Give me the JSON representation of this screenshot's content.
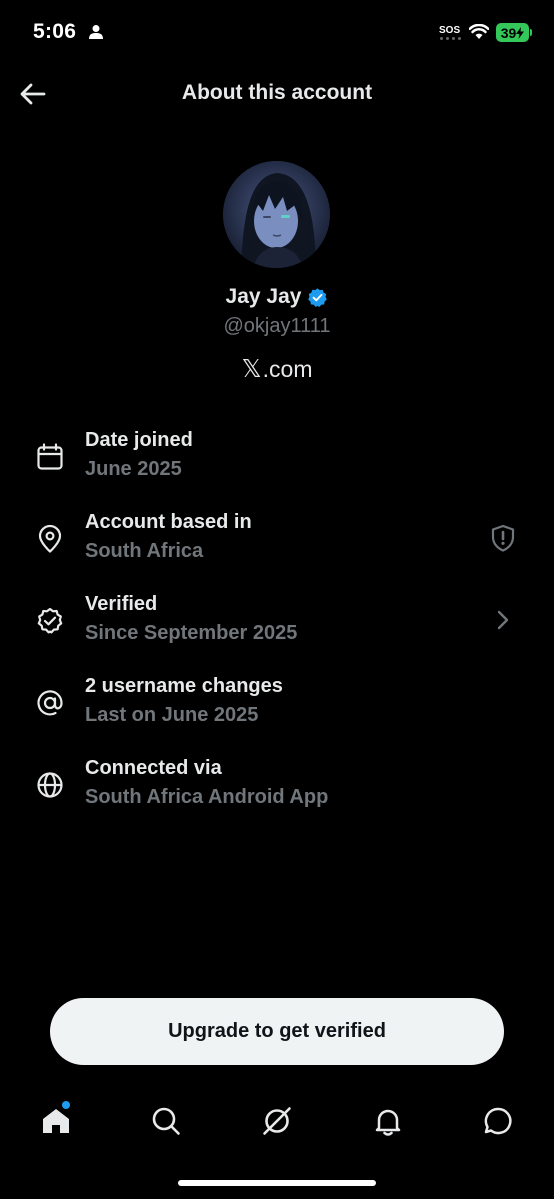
{
  "status_bar": {
    "time": "5:06",
    "sos": "SOS",
    "battery": "39"
  },
  "header": {
    "title": "About this account"
  },
  "profile": {
    "name": "Jay Jay",
    "handle": "@okjay1111",
    "domain_logo": "𝕏",
    "domain_text": ".com"
  },
  "details": [
    {
      "icon": "calendar-icon",
      "title": "Date joined",
      "subtitle": "June 2025"
    },
    {
      "icon": "location-pin-icon",
      "title": "Account based in",
      "subtitle": "South Africa",
      "trailing_icon": "shield-alert-icon"
    },
    {
      "icon": "verified-badge-icon",
      "title": "Verified",
      "subtitle": "Since September 2025",
      "trailing_icon": "chevron-right-icon"
    },
    {
      "icon": "at-sign-icon",
      "title": "2 username changes",
      "subtitle": "Last on June 2025"
    },
    {
      "icon": "globe-icon",
      "title": "Connected via",
      "subtitle": "South Africa Android App"
    }
  ],
  "upgrade": {
    "label": "Upgrade to get verified"
  },
  "bottom_nav": [
    "home-icon",
    "search-icon",
    "grok-icon",
    "notifications-icon",
    "messages-icon"
  ],
  "colors": {
    "background": "#000000",
    "primary_text": "#e7e9ea",
    "secondary_text": "#71767b",
    "verified_blue": "#1d9bf0",
    "battery_green": "#34c759"
  }
}
